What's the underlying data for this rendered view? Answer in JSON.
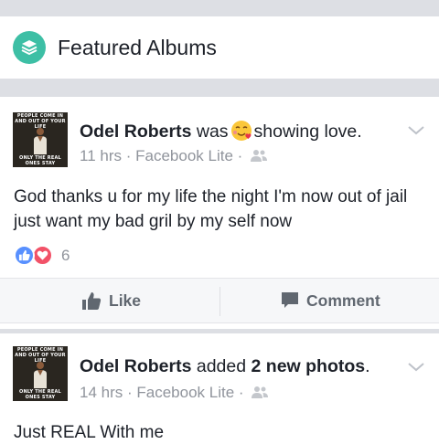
{
  "featured": {
    "title": "Featured Albums",
    "icon": "albums-stack-icon",
    "icon_color": "#3dbfa5"
  },
  "posts": [
    {
      "avatar": {
        "top_text": "PEOPLE COME IN AND OUT OF YOUR LIFE",
        "bottom_text": "ONLY THE REAL ONES STAY"
      },
      "author": "Odel Roberts",
      "verb": "was",
      "activity_emoji": "smiling-hearts-emoji",
      "activity": "showing love.",
      "time": "11 hrs",
      "separator": "·",
      "source": "Facebook Lite",
      "privacy_icon": "friends-icon",
      "text": "God thanks u for my life the night I'm now out of jail just want my bad gril by my self now",
      "reactions": {
        "types": [
          "like",
          "love"
        ],
        "count": "6",
        "like_color": "#5890ff",
        "love_color": "#f25268"
      },
      "actions": {
        "like_label": "Like",
        "comment_label": "Comment"
      }
    },
    {
      "avatar": {
        "top_text": "PEOPLE COME IN AND OUT OF YOUR LIFE",
        "bottom_text": "ONLY THE REAL ONES STAY"
      },
      "author": "Odel Roberts",
      "verb": "added",
      "count_text": "2 new photos",
      "end": ".",
      "time": "14 hrs",
      "separator": "·",
      "source": "Facebook Lite",
      "privacy_icon": "friends-icon",
      "text": "Just REAL With me"
    }
  ]
}
